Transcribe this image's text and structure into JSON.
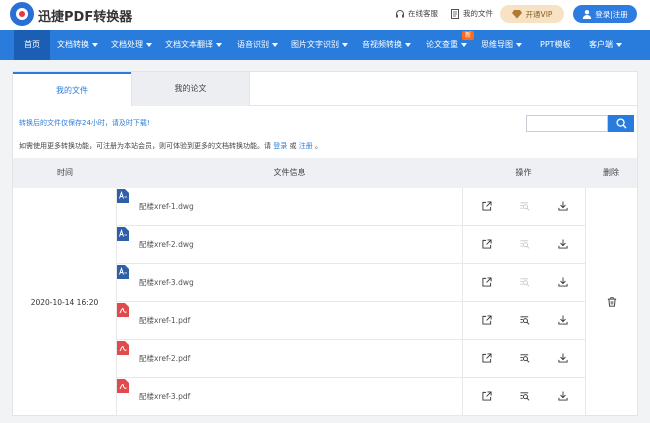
{
  "header": {
    "brand": "迅捷PDF转换器",
    "service_label": "在线客服",
    "myfiles_label": "我的文件",
    "vip_label": "开通VIP",
    "login_label": "登录|注册"
  },
  "nav": {
    "items": [
      {
        "label": "首页",
        "dropdown": false
      },
      {
        "label": "文档转换",
        "dropdown": true
      },
      {
        "label": "文档处理",
        "dropdown": true
      },
      {
        "label": "文档文本翻译",
        "dropdown": true
      },
      {
        "label": "语音识别",
        "dropdown": true
      },
      {
        "label": "图片文字识别",
        "dropdown": true
      },
      {
        "label": "音视频转换",
        "dropdown": true
      },
      {
        "label": "论文查重",
        "dropdown": true
      },
      {
        "label": "思维导图",
        "dropdown": true
      },
      {
        "label": "PPT模板",
        "dropdown": false
      },
      {
        "label": "客户端",
        "dropdown": true
      }
    ],
    "new_badge": "新"
  },
  "tabs": {
    "files": "我的文件",
    "papers": "我的论文"
  },
  "notice": "转换后的文件仅保存24小时，请及时下载!",
  "hint": {
    "prefix": "如需使用更多转换功能，可注册为本站会员，则可体验到更多的文档转换功能。请",
    "login": "登录",
    "or": "或",
    "register": "注册",
    "suffix": "。"
  },
  "search": {
    "value": ""
  },
  "table": {
    "headers": {
      "time": "时间",
      "info": "文件信息",
      "ops": "操作",
      "delete": "删除"
    },
    "time": "2020-10-14 16:20",
    "files": [
      {
        "name": "配楼xref-1.dwg",
        "type": "dwg",
        "preview_enabled": false
      },
      {
        "name": "配楼xref-2.dwg",
        "type": "dwg",
        "preview_enabled": false
      },
      {
        "name": "配楼xref-3.dwg",
        "type": "dwg",
        "preview_enabled": false
      },
      {
        "name": "配楼xref-1.pdf",
        "type": "pdf",
        "preview_enabled": true
      },
      {
        "name": "配楼xref-2.pdf",
        "type": "pdf",
        "preview_enabled": true
      },
      {
        "name": "配楼xref-3.pdf",
        "type": "pdf",
        "preview_enabled": true
      }
    ]
  },
  "icons": {
    "open": "external-link-icon",
    "preview": "preview-search-icon",
    "download": "download-icon",
    "delete": "trash-icon",
    "dwg": "dwg-file-icon",
    "pdf": "pdf-file-icon"
  },
  "colors": {
    "primary": "#2a7cdc",
    "nav_active": "#1a5fb4",
    "vip_bg": "#f7e3c4",
    "pdf_red": "#e04a4a",
    "dwg_blue": "#2f5fa8"
  }
}
